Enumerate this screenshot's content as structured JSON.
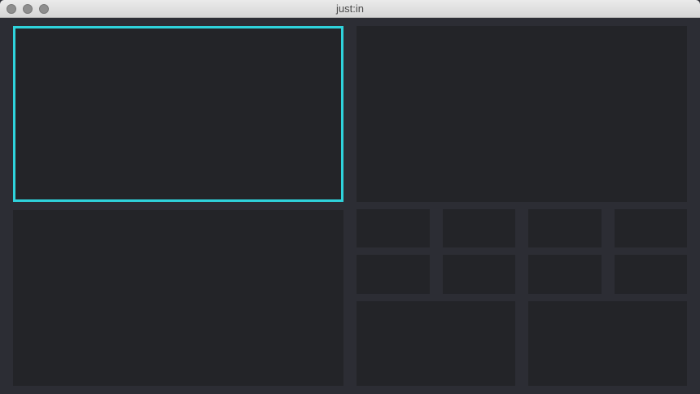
{
  "window": {
    "title": "just:in",
    "selected_tile": "video-tile-1",
    "accent_color": "#2fd3dc",
    "tile_color": "#232428",
    "background_color": "#2c2d34"
  }
}
